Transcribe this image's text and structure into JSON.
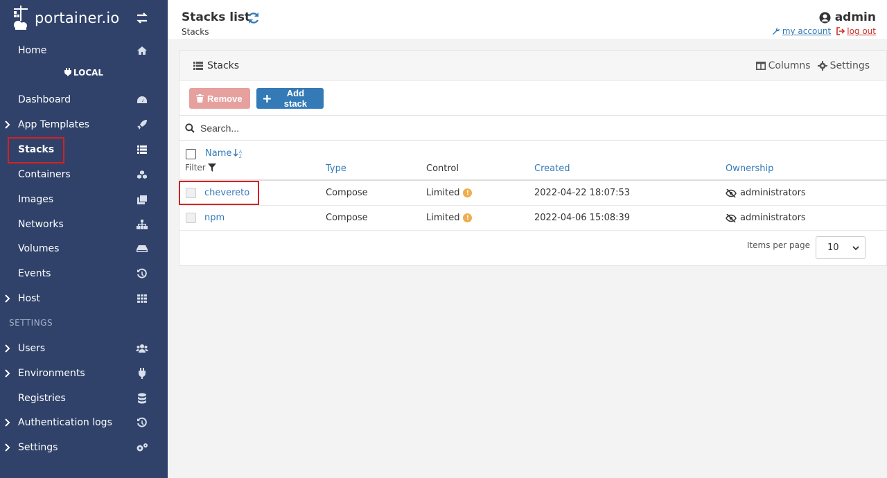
{
  "sidebar": {
    "brand": "portainer.io",
    "home_label": "Home",
    "environment": "LOCAL",
    "items": [
      {
        "label": "Dashboard"
      },
      {
        "label": "App Templates"
      },
      {
        "label": "Stacks"
      },
      {
        "label": "Containers"
      },
      {
        "label": "Images"
      },
      {
        "label": "Networks"
      },
      {
        "label": "Volumes"
      },
      {
        "label": "Events"
      },
      {
        "label": "Host"
      }
    ],
    "settings_section": "SETTINGS",
    "settings_items": [
      {
        "label": "Users"
      },
      {
        "label": "Environments"
      },
      {
        "label": "Registries"
      },
      {
        "label": "Authentication logs"
      },
      {
        "label": "Settings"
      }
    ]
  },
  "header": {
    "title": "Stacks list",
    "breadcrumb": "Stacks",
    "username": "admin",
    "my_account": "my account",
    "log_out": "log out"
  },
  "widget": {
    "title": "Stacks",
    "columns_label": "Columns",
    "settings_label": "Settings",
    "remove_label": "Remove",
    "add_label": "Add stack",
    "search_placeholder": "Search...",
    "columns": {
      "name": "Name",
      "filter": "Filter",
      "type": "Type",
      "control": "Control",
      "created": "Created",
      "ownership": "Ownership"
    },
    "rows": [
      {
        "name": "chevereto",
        "type": "Compose",
        "control": "Limited",
        "created": "2022-04-22 18:07:53",
        "ownership": "administrators"
      },
      {
        "name": "npm",
        "type": "Compose",
        "control": "Limited",
        "created": "2022-04-06 15:08:39",
        "ownership": "administrators"
      }
    ],
    "items_per_page_label": "Items per page",
    "items_per_page_value": "10"
  },
  "colors": {
    "sidebar_bg": "#30426a",
    "primary": "#337ab7",
    "danger": "#e6a09e",
    "warning": "#f0ad4e",
    "highlight": "#d62121"
  }
}
